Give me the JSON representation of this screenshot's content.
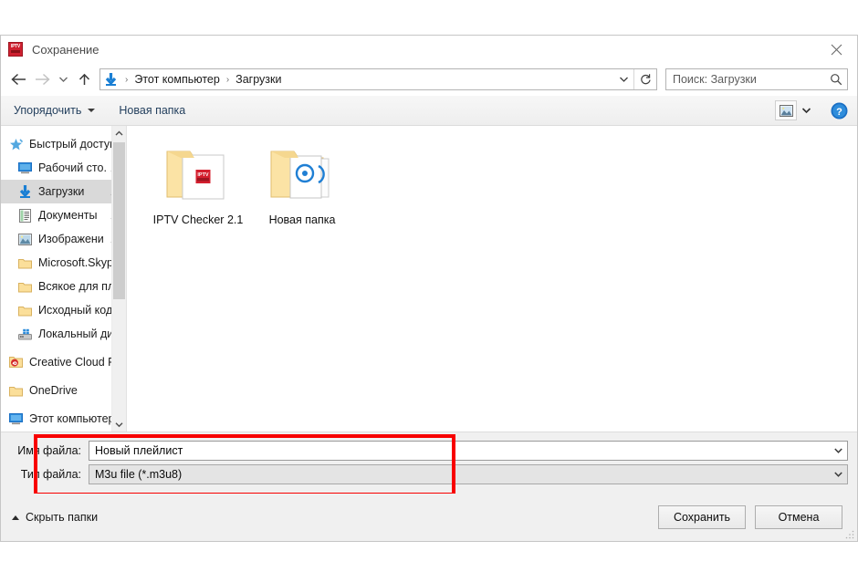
{
  "window": {
    "title": "Сохранение",
    "app_icon_label": "IPTV",
    "close_icon": "close-icon"
  },
  "navigation": {
    "back_icon": "back-arrow-icon",
    "forward_icon": "forward-arrow-icon",
    "history_icon": "chevron-down-icon",
    "up_icon": "up-arrow-icon",
    "address": {
      "location_icon": "downloads-arrow-icon",
      "crumbs": [
        "Этот компьютер",
        "Загрузки"
      ],
      "separator": "›",
      "dropdown_icon": "chevron-down-icon",
      "refresh_icon": "refresh-icon"
    },
    "search": {
      "placeholder": "Поиск: Загрузки",
      "value": "",
      "icon": "search-icon"
    }
  },
  "toolbar": {
    "organize_label": "Упорядочить",
    "new_folder_label": "Новая папка",
    "view_icon": "view-layout-icon",
    "view_dropdown_icon": "chevron-down-icon",
    "help_icon": "help-question-icon",
    "help_label": "?"
  },
  "sidebar": {
    "items": [
      {
        "label": "Быстрый доступ",
        "icon": "quick-access-star-icon",
        "selected": false,
        "pinned": false,
        "indent": "root"
      },
      {
        "label": "Рабочий сто.",
        "icon": "desktop-icon",
        "selected": false,
        "pinned": true,
        "indent": "child"
      },
      {
        "label": "Загрузки",
        "icon": "downloads-arrow-icon",
        "selected": true,
        "pinned": true,
        "indent": "child"
      },
      {
        "label": "Документы",
        "icon": "documents-icon",
        "selected": false,
        "pinned": true,
        "indent": "child"
      },
      {
        "label": "Изображени",
        "icon": "pictures-icon",
        "selected": false,
        "pinned": true,
        "indent": "child"
      },
      {
        "label": "Microsoft.Skype",
        "icon": "folder-icon",
        "selected": false,
        "pinned": false,
        "indent": "child"
      },
      {
        "label": "Всякое для плеи",
        "icon": "folder-icon",
        "selected": false,
        "pinned": false,
        "indent": "child"
      },
      {
        "label": "Исходный код",
        "icon": "folder-icon",
        "selected": false,
        "pinned": false,
        "indent": "child"
      },
      {
        "label": "Локальный дис",
        "icon": "local-disk-icon",
        "selected": false,
        "pinned": false,
        "indent": "child"
      },
      {
        "label": "Creative Cloud Fil",
        "icon": "creative-cloud-icon",
        "selected": false,
        "pinned": false,
        "indent": "root"
      },
      {
        "label": "OneDrive",
        "icon": "folder-icon",
        "selected": false,
        "pinned": false,
        "indent": "root"
      },
      {
        "label": "Этот компьютер",
        "icon": "this-pc-icon",
        "selected": false,
        "pinned": false,
        "indent": "root"
      }
    ],
    "scroll_up_icon": "chevron-up-icon",
    "scroll_down_icon": "chevron-down-icon"
  },
  "files": [
    {
      "name": "IPTV Checker 2.1",
      "icon": "folder-with-iptv-doc-icon"
    },
    {
      "name": "Новая папка",
      "icon": "folder-with-media-doc-icon"
    }
  ],
  "fields": {
    "file_name_label": "Имя файла:",
    "file_name_value": "Новый плейлист",
    "file_type_label": "Тип файла:",
    "file_type_value": "M3u file (*.m3u8)",
    "dropdown_icon": "chevron-down-icon"
  },
  "footer": {
    "hide_folders_label": "Скрыть папки",
    "hide_folders_icon": "chevron-up-icon",
    "save_label": "Сохранить",
    "cancel_label": "Отмена",
    "resize_grip_icon": "resize-grip-icon"
  },
  "annotation": {
    "highlight_color": "#f80000"
  }
}
